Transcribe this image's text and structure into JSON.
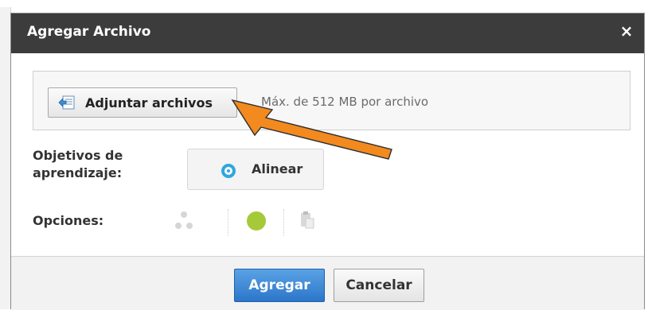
{
  "dialog": {
    "title": "Agregar Archivo",
    "close_glyph": "×"
  },
  "upload": {
    "attach_label": "Adjuntar archivos",
    "limit_text": "Máx. de 512 MB por archivo"
  },
  "objectives": {
    "label_line1": "Objetivos de",
    "label_line2": "aprendizaje:",
    "align_label": "Alinear"
  },
  "options": {
    "label": "Opciones:",
    "status_color": "#a6c93a"
  },
  "footer": {
    "add_label": "Agregar",
    "cancel_label": "Cancelar"
  },
  "annotation": {
    "arrow_color": "#f28a1f"
  }
}
